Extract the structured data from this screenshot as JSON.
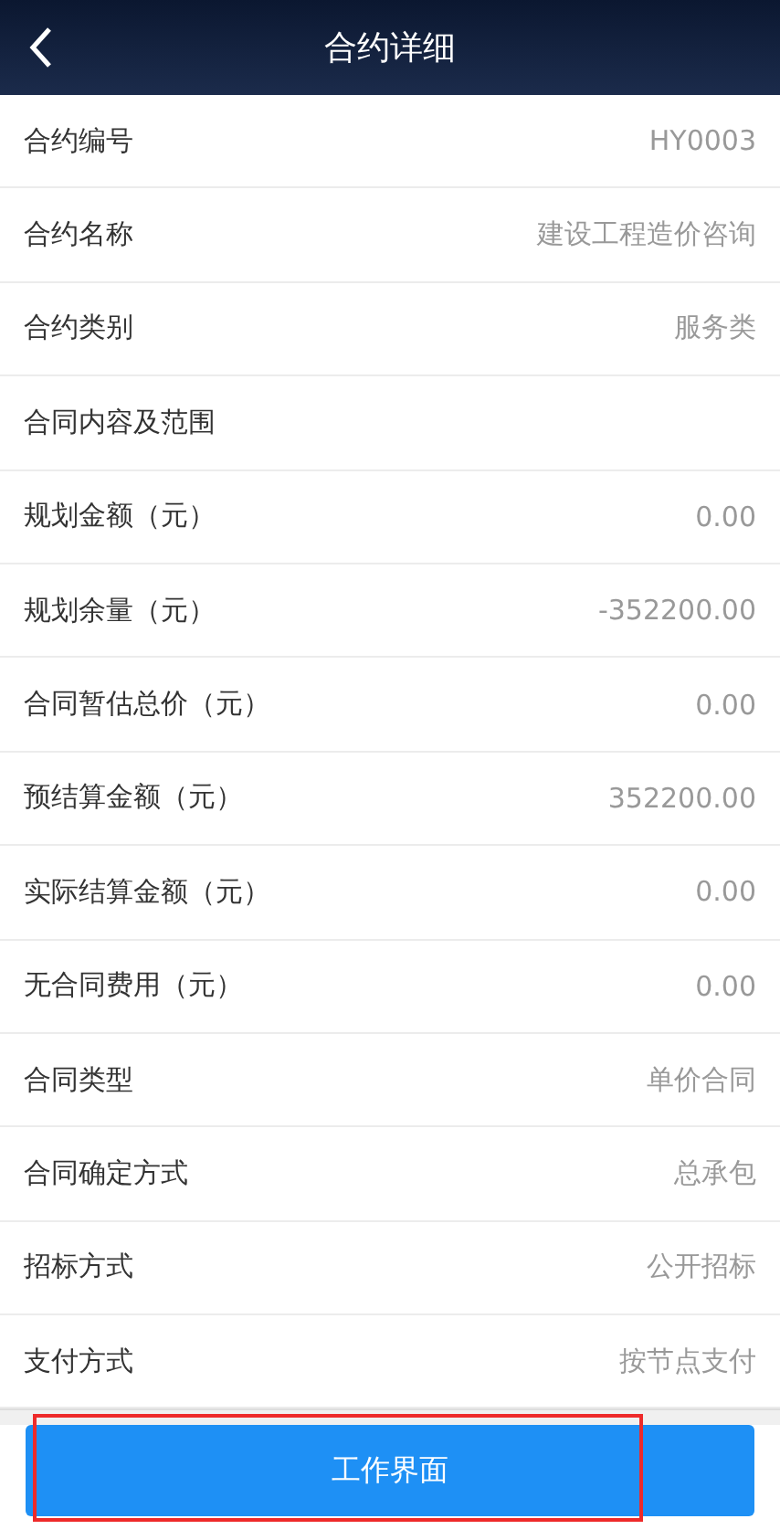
{
  "header": {
    "title": "合约详细"
  },
  "rows": [
    {
      "label": "合约编号",
      "value": "HY0003"
    },
    {
      "label": "合约名称",
      "value": "建设工程造价咨询"
    },
    {
      "label": "合约类别",
      "value": "服务类"
    },
    {
      "label": "合同内容及范围"
    },
    {
      "label": "规划金额（元）",
      "value": "0.00"
    },
    {
      "label": "规划余量（元）",
      "value": "-352200.00"
    },
    {
      "label": "合同暂估总价（元）",
      "value": "0.00"
    },
    {
      "label": "预结算金额（元）",
      "value": "352200.00"
    },
    {
      "label": "实际结算金额（元）",
      "value": "0.00"
    },
    {
      "label": "无合同费用（元）",
      "value": "0.00"
    },
    {
      "label": "合同类型",
      "value": "单价合同"
    },
    {
      "label": "合同确定方式",
      "value": "总承包"
    },
    {
      "label": "招标方式",
      "value": "公开招标"
    },
    {
      "label": "支付方式",
      "value": "按节点支付"
    }
  ],
  "button": {
    "label": "工作界面"
  }
}
